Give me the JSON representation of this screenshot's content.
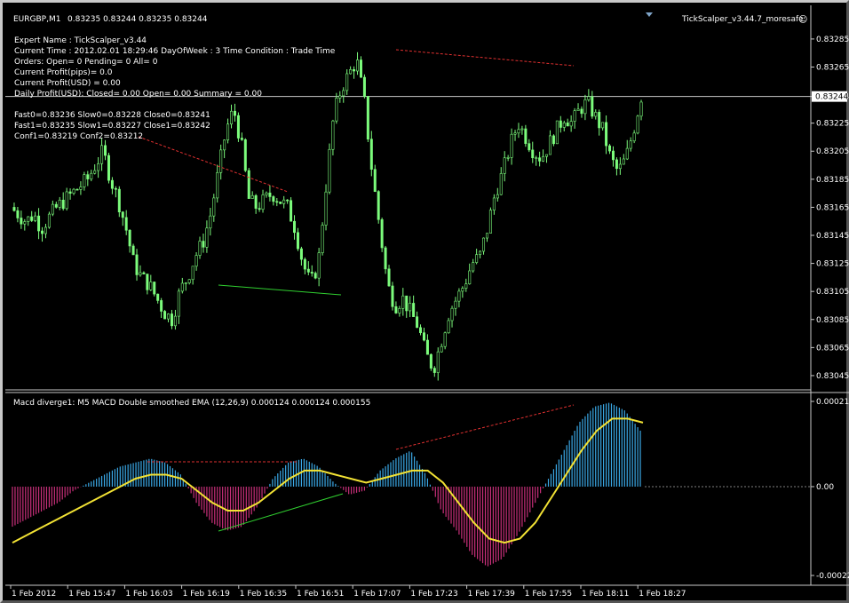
{
  "header": {
    "symbol": "EURGBP,M1",
    "ohlc": "0.83235 0.83244 0.83235 0.83244",
    "indicator_name": "TickScalper_v3.44.7_moresafe",
    "smiley": "☺"
  },
  "info_lines": [
    "Expert Name : TickScalper_v3.44",
    "Current Time : 2012.02.01 18:29:46 DayOfWeek : 3 Time Condition : Trade Time",
    "Orders: Open= 0 Pending= 0 All= 0",
    "Current Profit(pips)= 0.0",
    "Current Profit(USD) = 0.00",
    "Daily Profit(USD): Closed= 0.00 Open= 0.00 Summary = 0.00",
    "",
    "Fast0=0.83236 Slow0=0.83228 Close0=0.83241",
    "Fast1=0.83235 Slow1=0.83227 Close1=0.83242",
    "Conf1=0.83219 Conf2=0.83212"
  ],
  "macd_header": "Macd diverge1:  M5 MACD Double smoothed EMA (12,26,9) 0.000124 0.000124 0.000155",
  "colors": {
    "candle": "#7CFC7C",
    "macd_pos": "#3aa8e6",
    "macd_neg": "#c8307a",
    "signal": "#f2e234",
    "div_red": "#e03030",
    "div_green": "#30d030"
  },
  "chart_data": [
    {
      "type": "candlestick",
      "name": "EURGBP,M1",
      "price_axis_ticks": [
        "0.83285",
        "0.83265",
        "0.83244",
        "0.83225",
        "0.83205",
        "0.83185",
        "0.83165",
        "0.83145",
        "0.83125",
        "0.83105",
        "0.83085",
        "0.83065",
        "0.83045"
      ],
      "current_price": "0.83244",
      "ylim": [
        0.83038,
        0.8329
      ],
      "close_path": [
        0.83165,
        0.8316,
        0.83155,
        0.8316,
        0.8315,
        0.83158,
        0.83165,
        0.8317,
        0.83175,
        0.8318,
        0.83185,
        0.83195,
        0.83205,
        0.83185,
        0.8317,
        0.8315,
        0.83125,
        0.83115,
        0.8311,
        0.831,
        0.8309,
        0.83085,
        0.83105,
        0.83115,
        0.8313,
        0.8314,
        0.8316,
        0.8319,
        0.8322,
        0.83235,
        0.8321,
        0.8317,
        0.83165,
        0.8317,
        0.83175,
        0.8317,
        0.83165,
        0.8315,
        0.83125,
        0.8311,
        0.83125,
        0.8318,
        0.8323,
        0.8325,
        0.8326,
        0.8327,
        0.8324,
        0.8319,
        0.8315,
        0.8311,
        0.83095,
        0.831,
        0.8309,
        0.8308,
        0.8306,
        0.8305,
        0.8307,
        0.8309,
        0.831,
        0.8311,
        0.83125,
        0.8313,
        0.8315,
        0.83175,
        0.8319,
        0.8321,
        0.83225,
        0.83215,
        0.83205,
        0.832,
        0.8321,
        0.8322,
        0.8323,
        0.83225,
        0.83235,
        0.8324,
        0.8323,
        0.8322,
        0.832,
        0.8319,
        0.832,
        0.8322,
        0.83244
      ]
    },
    {
      "type": "bar",
      "name": "MACD Double smoothed EMA (12,26,9)",
      "value_axis_ticks": [
        "0.000213",
        "0.00",
        "-0.000222"
      ],
      "ylim": [
        -0.000222,
        0.000213
      ],
      "histogram": [
        -0.0001,
        -8e-05,
        -6e-05,
        -4e-05,
        -1e-05,
        1e-05,
        3e-05,
        5e-05,
        6e-05,
        7e-05,
        6e-05,
        3e-05,
        -4e-05,
        -9e-05,
        -0.00011,
        -0.0001,
        -5e-05,
        2e-05,
        6e-05,
        7e-05,
        5e-05,
        1e-05,
        -2e-05,
        -1e-05,
        4e-05,
        7e-05,
        9e-05,
        3e-05,
        -6e-05,
        -0.00011,
        -0.00017,
        -0.0002,
        -0.00018,
        -0.00012,
        -5e-05,
        2e-05,
        9e-05,
        0.00016,
        0.0002,
        0.00021,
        0.00019,
        0.00014
      ],
      "signal": [
        -0.00014,
        -0.00012,
        -0.0001,
        -8e-05,
        -6e-05,
        -4e-05,
        -2e-05,
        0.0,
        2e-05,
        3e-05,
        3e-05,
        2e-05,
        -1e-05,
        -4e-05,
        -6e-05,
        -6e-05,
        -4e-05,
        -1e-05,
        2e-05,
        4e-05,
        4e-05,
        3e-05,
        2e-05,
        1e-05,
        2e-05,
        3e-05,
        4e-05,
        4e-05,
        1e-05,
        -4e-05,
        -9e-05,
        -0.00013,
        -0.00014,
        -0.00013,
        -9e-05,
        -3e-05,
        3e-05,
        9e-05,
        0.00014,
        0.00017,
        0.00017,
        0.00016
      ]
    }
  ],
  "time_axis": [
    "1 Feb 2012",
    "1 Feb 15:47",
    "1 Feb 16:03",
    "1 Feb 16:19",
    "1 Feb 16:35",
    "1 Feb 16:51",
    "1 Feb 17:07",
    "1 Feb 17:23",
    "1 Feb 17:39",
    "1 Feb 17:55",
    "1 Feb 18:11",
    "1 Feb 18:27"
  ]
}
